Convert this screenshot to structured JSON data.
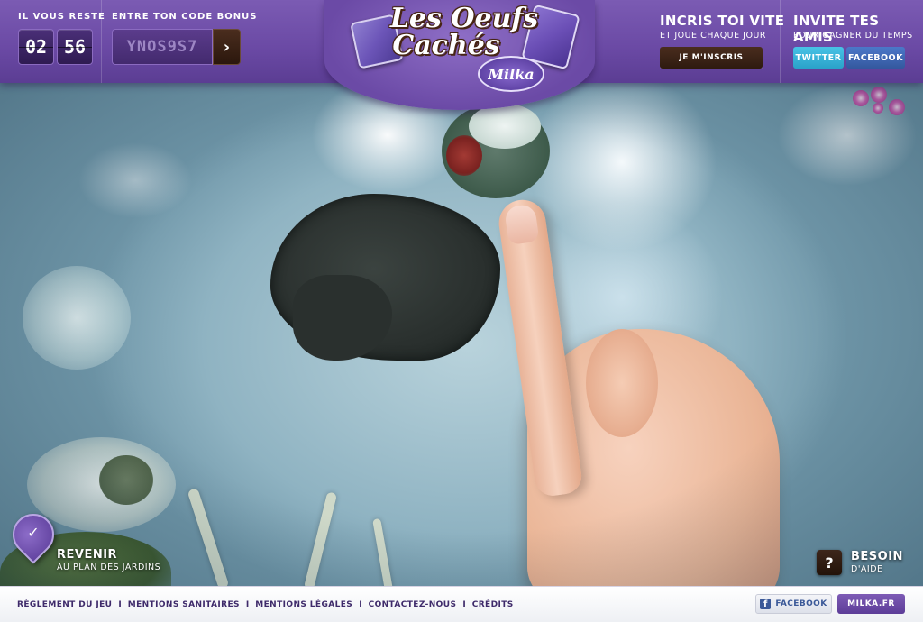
{
  "header": {
    "timer": {
      "label": "IL VOUS RESTE",
      "minutes": "02",
      "seconds": "56"
    },
    "bonus": {
      "label": "ENTRE TON CODE BONUS",
      "code_value": "YNOS9S7",
      "submit_icon": "chevron-right-icon"
    },
    "logo": {
      "title_line1": "Les Oeufs",
      "title_line2": "Cachés",
      "brand": "Milka"
    },
    "signup": {
      "title": "INCRIS TOI VITE",
      "subtitle": "ET JOUE CHAQUE JOUR",
      "button": "JE M'INSCRIS"
    },
    "invite": {
      "title": "INVITE TES AMIS",
      "subtitle": "POUR GAGNER DU TEMPS",
      "twitter": "TWITTER",
      "facebook": "FACEBOOK"
    }
  },
  "controls": {
    "back": {
      "title": "REVENIR",
      "subtitle": "AU PLAN DES JARDINS",
      "icon": "checkmark-pin-icon"
    },
    "help": {
      "title": "BESOIN",
      "subtitle": "D'AIDE",
      "icon": "question-icon"
    }
  },
  "footer": {
    "links": [
      "RÈGLEMENT DU JEU",
      "MENTIONS SANITAIRES",
      "MENTIONS LÉGALES",
      "CONTACTEZ-NOUS",
      "CRÉDITS"
    ],
    "facebook": "FACEBOOK",
    "milka": "MILKA.FR"
  },
  "colors": {
    "brand_purple": "#6a49a4",
    "dark_brown": "#2e1a0f",
    "twitter": "#2aa2c9",
    "facebook": "#34589e"
  }
}
